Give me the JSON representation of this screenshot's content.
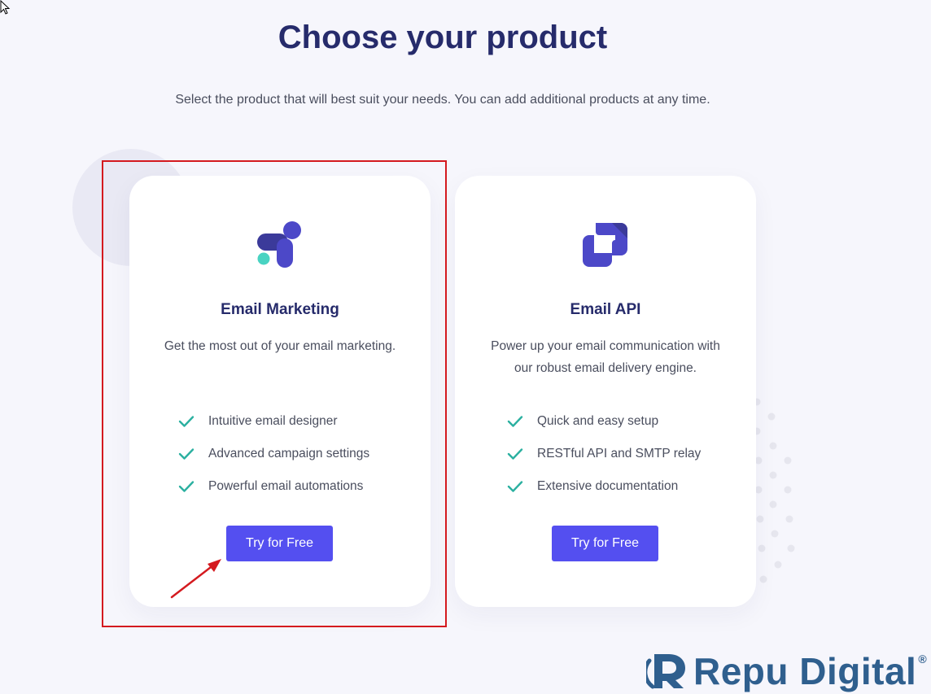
{
  "header": {
    "title": "Choose your product",
    "subtitle": "Select the product that will best suit your needs. You can add additional products at any time."
  },
  "products": [
    {
      "name": "Email Marketing",
      "description": "Get the most out of your email marketing.",
      "logo_icon": "email-marketing-logo-icon",
      "features": [
        "Intuitive email designer",
        "Advanced campaign settings",
        "Powerful email automations"
      ],
      "button_label": "Try for Free"
    },
    {
      "name": "Email API",
      "description": "Power up your email communication with our robust email delivery engine.",
      "logo_icon": "email-api-logo-icon",
      "features": [
        "Quick and easy setup",
        "RESTful API and SMTP relay",
        "Extensive documentation"
      ],
      "button_label": "Try for Free"
    }
  ],
  "watermark": {
    "text": "Repu Digital",
    "registered": "®"
  },
  "colors": {
    "title": "#262b6b",
    "accent_button": "#544ff0",
    "check": "#2bb0a0",
    "highlight": "#d41a1f",
    "teal_dot": "#49d3c2",
    "background": "#f6f6fc"
  }
}
